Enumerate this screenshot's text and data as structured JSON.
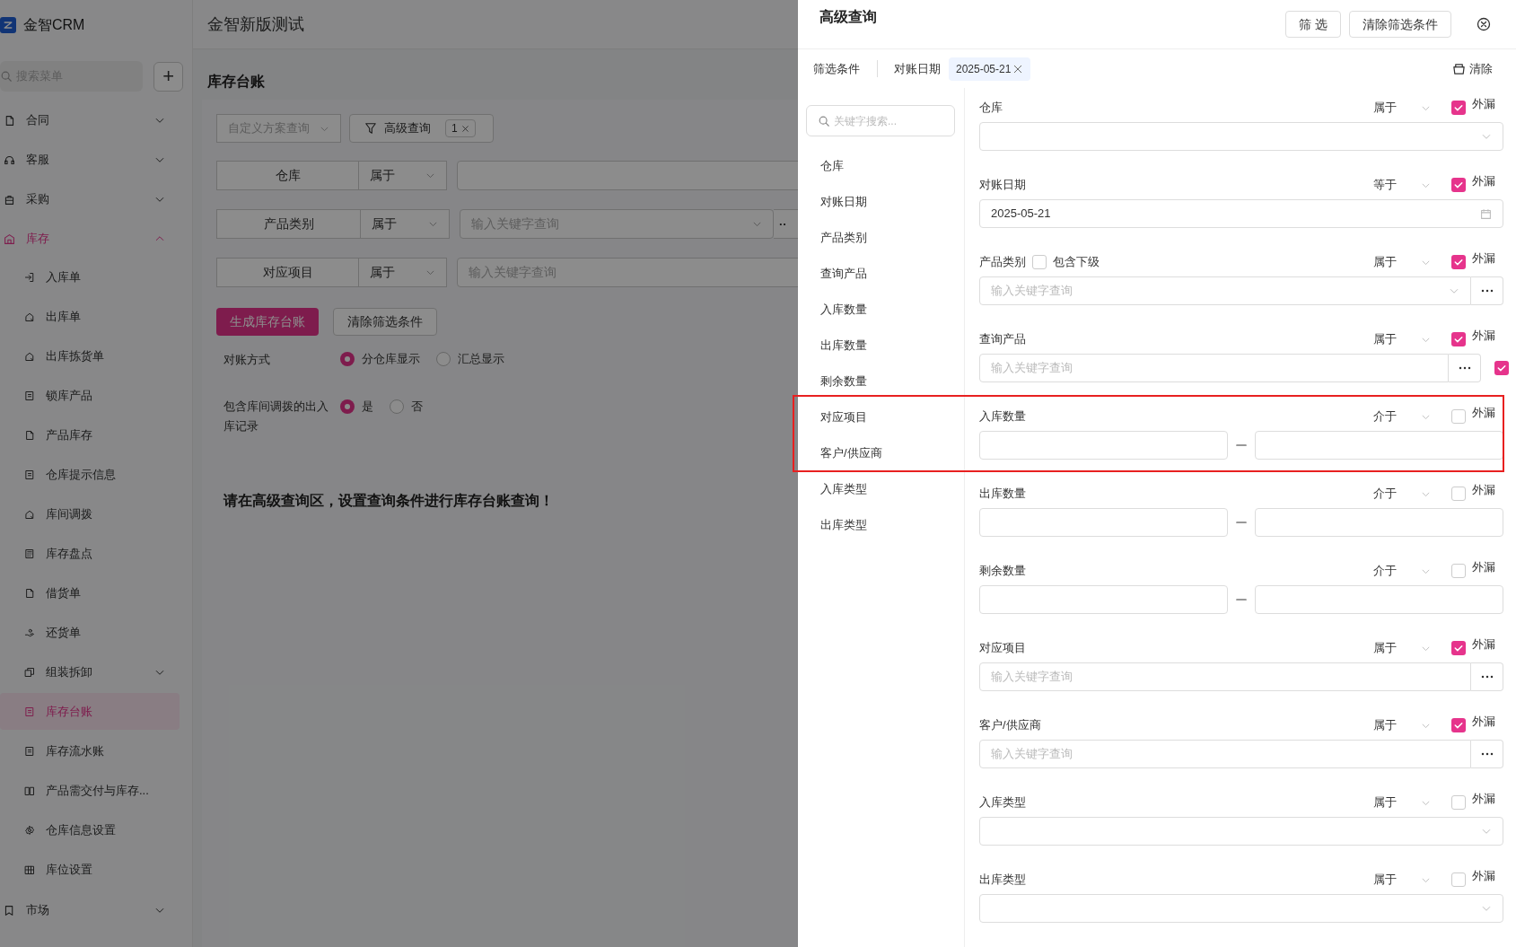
{
  "app": {
    "logo": "金智CRM",
    "menu_search": {
      "placeholder": "搜索菜单"
    },
    "add_button": "+",
    "workspace": "金智新版测试"
  },
  "sidebar": {
    "items": [
      {
        "label": "合同",
        "expanded": false,
        "selected": false
      },
      {
        "label": "客服",
        "expanded": false,
        "selected": false
      },
      {
        "label": "采购",
        "expanded": false,
        "selected": false
      },
      {
        "label": "库存",
        "expanded": true,
        "selected": true,
        "children": [
          {
            "label": "入库单",
            "selected": false
          },
          {
            "label": "出库单",
            "selected": false
          },
          {
            "label": "出库拣货单",
            "selected": false
          },
          {
            "label": "锁库产品",
            "selected": false
          },
          {
            "label": "产品库存",
            "selected": false
          },
          {
            "label": "仓库提示信息",
            "selected": false
          },
          {
            "label": "库间调拨",
            "selected": false
          },
          {
            "label": "库存盘点",
            "selected": false
          },
          {
            "label": "借货单",
            "selected": false
          },
          {
            "label": "还货单",
            "selected": false
          },
          {
            "label": "组装拆卸",
            "selected": false,
            "expanded": false
          },
          {
            "label": "库存台账",
            "selected": true
          },
          {
            "label": "库存流水账",
            "selected": false
          },
          {
            "label": "产品需交付与库存...",
            "selected": false
          },
          {
            "label": "仓库信息设置",
            "selected": false
          },
          {
            "label": "库位设置",
            "selected": false
          }
        ]
      },
      {
        "label": "市场",
        "expanded": false,
        "selected": false
      }
    ]
  },
  "page": {
    "title": "库存台账",
    "scheme_select": {
      "placeholder": "自定义方案查询"
    },
    "advanced_button": {
      "label": "高级查询",
      "count": "1"
    },
    "filters": [
      {
        "label": "仓库",
        "operator": "属于",
        "kind": "select"
      },
      {
        "label": "产品类别",
        "operator": "属于",
        "kind": "select_more",
        "placeholder": "输入关键字查询",
        "more": "··"
      },
      {
        "label": "对应项目",
        "operator": "属于",
        "kind": "text",
        "placeholder": "输入关键字查询"
      }
    ],
    "actions": [
      {
        "label": "生成库存台账",
        "primary": true
      },
      {
        "label": "清除筛选条件",
        "primary": false
      }
    ],
    "radio_groups": [
      {
        "label": "对账方式",
        "options": [
          {
            "label": "分仓库显示",
            "selected": true
          },
          {
            "label": "汇总显示",
            "selected": false
          }
        ]
      },
      {
        "label": "包含库间调拨的出入库记录",
        "options": [
          {
            "label": "是",
            "selected": true
          },
          {
            "label": "否",
            "selected": false
          }
        ]
      }
    ],
    "message": "请在高级查询区，设置查询条件进行库存台账查询！"
  },
  "drawer": {
    "title": "高级查询",
    "buttons": [
      {
        "label": "筛 选"
      },
      {
        "label": "清除筛选条件"
      }
    ],
    "conditions_label": "筛选条件",
    "active_conditions": [
      {
        "field": "对账日期",
        "value": "2025-05-21"
      }
    ],
    "clear_all": "清除",
    "field_search": {
      "placeholder": "关键字搜索..."
    },
    "field_list": [
      "仓库",
      "对账日期",
      "产品类别",
      "查询产品",
      "入库数量",
      "出库数量",
      "剩余数量",
      "对应项目",
      "客户/供应商",
      "入库类型",
      "出库类型"
    ],
    "fields": [
      {
        "label": "仓库",
        "operator": "属于",
        "outer_label": "外漏",
        "outer": true,
        "kind": "select"
      },
      {
        "label": "对账日期",
        "operator": "等于",
        "outer_label": "外漏",
        "outer": true,
        "kind": "date",
        "value": "2025-05-21"
      },
      {
        "label": "产品类别",
        "operator": "属于",
        "outer_label": "外漏",
        "outer": true,
        "kind": "select_more",
        "placeholder": "输入关键字查询",
        "include_sub": {
          "label": "包含下级",
          "checked": false
        }
      },
      {
        "label": "查询产品",
        "operator": "属于",
        "outer_label": "外漏",
        "outer": true,
        "kind": "text_more",
        "placeholder": "输入关键字查询",
        "extra_checked": true
      },
      {
        "label": "入库数量",
        "operator": "介于",
        "outer_label": "外漏",
        "outer": false,
        "kind": "range"
      },
      {
        "label": "出库数量",
        "operator": "介于",
        "outer_label": "外漏",
        "outer": false,
        "kind": "range"
      },
      {
        "label": "剩余数量",
        "operator": "介于",
        "outer_label": "外漏",
        "outer": false,
        "kind": "range"
      },
      {
        "label": "对应项目",
        "operator": "属于",
        "outer_label": "外漏",
        "outer": true,
        "kind": "text_more",
        "placeholder": "输入关键字查询"
      },
      {
        "label": "客户/供应商",
        "operator": "属于",
        "outer_label": "外漏",
        "outer": true,
        "kind": "text_more",
        "placeholder": "输入关键字查询"
      },
      {
        "label": "入库类型",
        "operator": "属于",
        "outer_label": "外漏",
        "outer": false,
        "kind": "select"
      },
      {
        "label": "出库类型",
        "operator": "属于",
        "outer_label": "外漏",
        "outer": false,
        "kind": "select"
      }
    ]
  },
  "annotation": {
    "kind": "red-frame"
  }
}
